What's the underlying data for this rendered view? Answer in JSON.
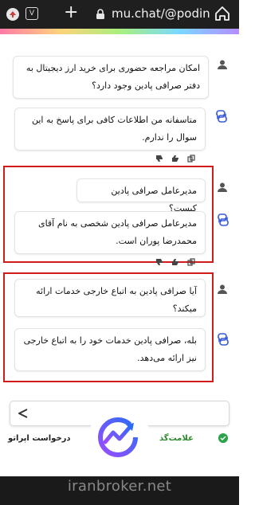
{
  "browser": {
    "tab_count": "V",
    "url": "mu.chat/@podin"
  },
  "chat": {
    "messages": [
      {
        "role": "user",
        "text": "امکان مراجعه حضوری برای خرید ارز دیجیتال به دفتر صرافی پادین وجود دارد؟"
      },
      {
        "role": "bot",
        "text": "متاسفانه من اطلاعات کافی برای پاسخ به این سوال را ندارم."
      },
      {
        "role": "user",
        "text": "مدیرعامل صرافی پادین کیست؟"
      },
      {
        "role": "bot",
        "text": "مدیرعامل صرافی پادین شخصی به نام آقای محمدرضا پوران است."
      },
      {
        "role": "user",
        "text": "آیا صرافی پادین به اتباع خارجی خدمات ارائه میکند؟"
      },
      {
        "role": "bot",
        "text": "بله، صرافی پادین خدمات خود را به اتباع خارجی نیز ارائه می‌دهد."
      }
    ]
  },
  "footer": {
    "left_text": "درخواست اپراتو",
    "right_text": "علامت‌گذ"
  },
  "watermark": {
    "text": "iranbroker.net"
  },
  "colors": {
    "highlight": "#d11a1a",
    "bot_avatar": "#3a5bd9",
    "logo_gradient": [
      "#2b6cf6",
      "#9b4dff"
    ]
  }
}
